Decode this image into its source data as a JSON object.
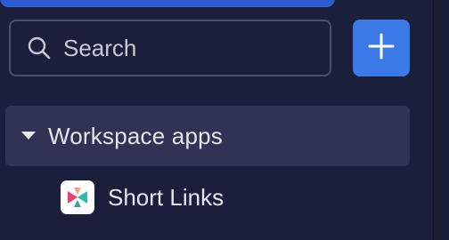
{
  "search": {
    "placeholder": "Search",
    "value": ""
  },
  "toolbar": {
    "add_icon": "plus-icon"
  },
  "workspace": {
    "section_label": "Workspace apps",
    "expanded_icon": "caret-down-icon",
    "apps": [
      {
        "label": "Short Links",
        "icon": "short-links-logo"
      }
    ]
  },
  "colors": {
    "background": "#1c1f3b",
    "accent": "#3b78e8",
    "section_bg": "#303351"
  }
}
